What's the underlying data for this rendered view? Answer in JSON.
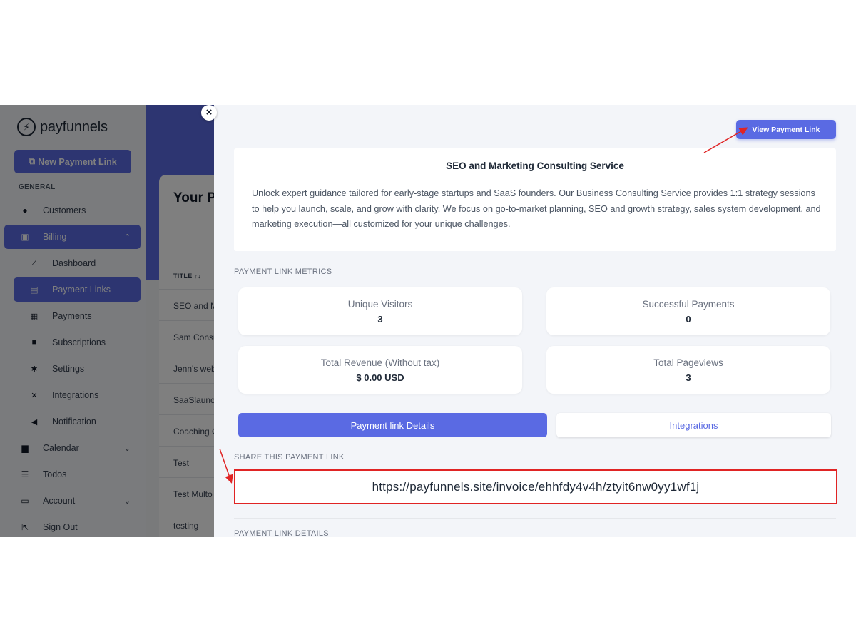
{
  "sidebar": {
    "brand": "payfunnels",
    "new_button": "New Payment Link",
    "section_label": "GENERAL",
    "items": [
      {
        "label": "Customers",
        "icon": "user-icon"
      },
      {
        "label": "Billing",
        "icon": "billing-icon"
      },
      {
        "label": "Dashboard",
        "icon": "chart-icon"
      },
      {
        "label": "Payment Links",
        "icon": "link-icon"
      },
      {
        "label": "Payments",
        "icon": "payments-icon"
      },
      {
        "label": "Subscriptions",
        "icon": "subscriptions-icon"
      },
      {
        "label": "Settings",
        "icon": "gear-icon"
      },
      {
        "label": "Integrations",
        "icon": "tools-icon"
      },
      {
        "label": "Notification",
        "icon": "megaphone-icon"
      },
      {
        "label": "Calendar",
        "icon": "calendar-icon"
      },
      {
        "label": "Todos",
        "icon": "list-icon"
      },
      {
        "label": "Account",
        "icon": "id-card-icon"
      },
      {
        "label": "Sign Out",
        "icon": "running-icon"
      }
    ]
  },
  "background": {
    "title": "Your P",
    "column_header": "TITLE ↑↓",
    "rows": [
      "SEO and M",
      "Sam Consu",
      "Jenn's web",
      "SaaSlaunch",
      "Coaching C",
      "Test",
      "Test Multo",
      "testing"
    ]
  },
  "modal": {
    "close_label": "×",
    "view_button": "View Payment Link",
    "service_title": "SEO and Marketing Consulting Service",
    "service_description": "Unlock expert guidance tailored for early-stage startups and SaaS founders. Our Business Consulting Service provides 1:1 strategy sessions to help you launch, scale, and grow with clarity. We focus on go-to-market planning, SEO and growth strategy, sales system development, and marketing execution—all customized for your unique challenges.",
    "metrics_label": "PAYMENT LINK METRICS",
    "metrics": {
      "unique_visitors": {
        "label": "Unique Visitors",
        "value": "3"
      },
      "successful_payments": {
        "label": "Successful Payments",
        "value": "0"
      },
      "total_revenue": {
        "label": "Total Revenue (Without tax)",
        "value": "$ 0.00 USD"
      },
      "total_pageviews": {
        "label": "Total Pageviews",
        "value": "3"
      }
    },
    "tabs": {
      "details": "Payment link Details",
      "integrations": "Integrations"
    },
    "share_label": "SHARE THIS PAYMENT LINK",
    "share_url": "https://payfunnels.site/invoice/ehhfdy4v4h/ztyit6nw0yy1wf1j",
    "details_label": "PAYMENT LINK DETAILS"
  },
  "colors": {
    "accent": "#5a6ae3",
    "highlight": "#e02424"
  }
}
